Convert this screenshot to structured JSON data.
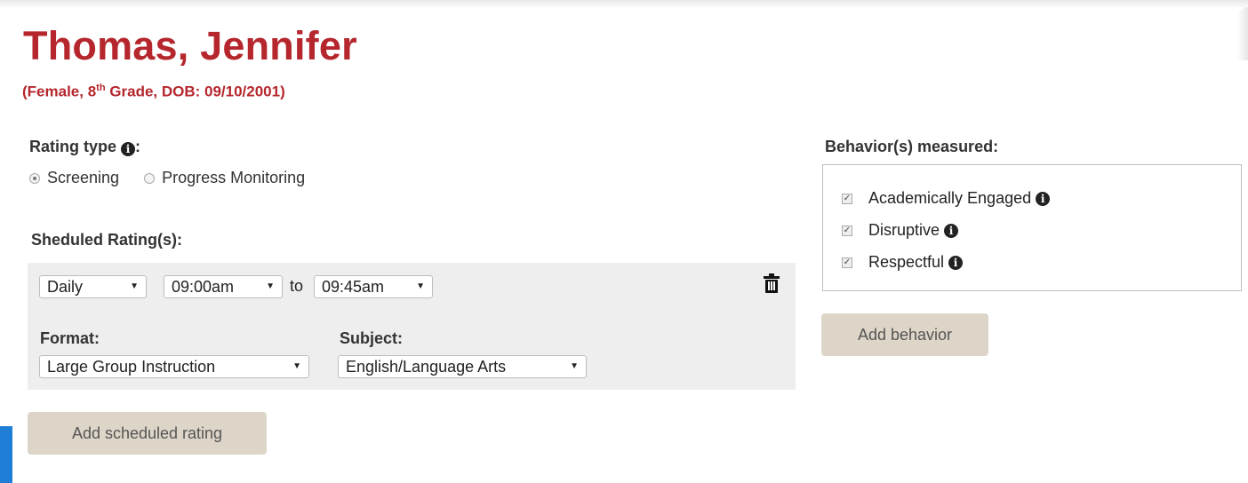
{
  "student": {
    "name": "Thomas, Jennifer",
    "info_prefix": "(Female, 8",
    "info_sup": "th",
    "info_suffix": " Grade, DOB: 09/10/2001)"
  },
  "rating_type": {
    "label": "Rating type",
    "options": [
      {
        "label": "Screening",
        "selected": true
      },
      {
        "label": "Progress Monitoring",
        "selected": false
      }
    ]
  },
  "scheduled": {
    "label": "Sheduled Rating(s):",
    "frequency": "Daily",
    "start_time": "09:00am",
    "to_text": "to",
    "end_time": "09:45am",
    "format_label": "Format:",
    "format_value": "Large Group Instruction",
    "subject_label": "Subject:",
    "subject_value": "English/Language Arts",
    "add_button": "Add scheduled rating"
  },
  "behaviors": {
    "label": "Behavior(s) measured:",
    "items": [
      {
        "label": "Academically Engaged",
        "checked": true
      },
      {
        "label": "Disruptive",
        "checked": true
      },
      {
        "label": "Respectful",
        "checked": true
      }
    ],
    "add_button": "Add behavior"
  },
  "icons": {
    "info": "info-icon",
    "trash": "trash-icon",
    "caret": "chevron-down-icon"
  },
  "colors": {
    "name_color": "#b5272d",
    "button_bg": "#ddd5c7",
    "schedule_bg": "#eeeeee"
  }
}
